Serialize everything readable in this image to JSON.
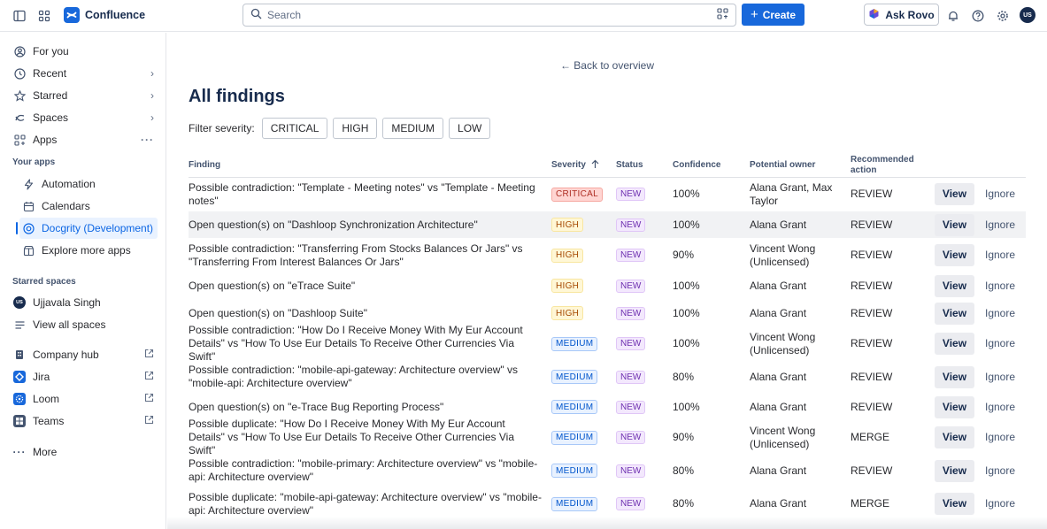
{
  "topbar": {
    "app_name": "Confluence",
    "search_placeholder": "Search",
    "create_label": "Create",
    "rovo_label": "Ask Rovo",
    "avatar_initials": "US"
  },
  "sidebar": {
    "main_items": [
      {
        "label": "For you",
        "icon": "user-circle-icon"
      },
      {
        "label": "Recent",
        "icon": "clock-icon"
      },
      {
        "label": "Starred",
        "icon": "star-icon"
      },
      {
        "label": "Spaces",
        "icon": "spaces-icon"
      },
      {
        "label": "Apps",
        "icon": "apps-grid-icon"
      }
    ],
    "your_apps_heading": "Your apps",
    "apps": [
      {
        "label": "Automation",
        "icon": "bolt-icon"
      },
      {
        "label": "Calendars",
        "icon": "calendar-icon"
      },
      {
        "label": "Docgrity (Development)",
        "icon": "docgrity-icon"
      },
      {
        "label": "Explore more apps",
        "icon": "marketplace-icon"
      }
    ],
    "starred_spaces_heading": "Starred spaces",
    "starred_space": {
      "label": "Ujjavala Singh",
      "initials": "US"
    },
    "view_all_spaces": "View all spaces",
    "external": [
      {
        "label": "Company hub",
        "icon": "company-hub-icon",
        "color": "#44546f"
      },
      {
        "label": "Jira",
        "icon": "jira-icon",
        "color": "#1868db"
      },
      {
        "label": "Loom",
        "icon": "loom-icon",
        "color": "#1868db"
      },
      {
        "label": "Teams",
        "icon": "teams-icon",
        "color": "#44546f"
      }
    ],
    "more_label": "More"
  },
  "main": {
    "back_link": "← Back to overview",
    "title": "All findings",
    "filter_label": "Filter severity:",
    "filters": [
      "CRITICAL",
      "HIGH",
      "MEDIUM",
      "LOW"
    ],
    "columns": {
      "finding": "Finding",
      "severity": "Severity",
      "status": "Status",
      "confidence": "Confidence",
      "owner": "Potential owner",
      "action": "Recommended action"
    },
    "view_label": "View",
    "ignore_label": "Ignore",
    "rows": [
      {
        "finding": "Possible contradiction: \"Template - Meeting notes\" vs \"Template - Meeting notes\"",
        "severity": "CRITICAL",
        "status": "NEW",
        "confidence": "100%",
        "owner": "Alana Grant, Max Taylor",
        "action": "REVIEW"
      },
      {
        "finding": "Open question(s) on \"Dashloop Synchronization Architecture\"",
        "severity": "HIGH",
        "status": "NEW",
        "confidence": "100%",
        "owner": "Alana Grant",
        "action": "REVIEW"
      },
      {
        "finding": "Possible contradiction: \"Transferring From Stocks Balances Or Jars\" vs \"Transferring From Interest Balances Or Jars\"",
        "severity": "HIGH",
        "status": "NEW",
        "confidence": "90%",
        "owner": "Vincent Wong (Unlicensed)",
        "action": "REVIEW"
      },
      {
        "finding": "Open question(s) on \"eTrace Suite\"",
        "severity": "HIGH",
        "status": "NEW",
        "confidence": "100%",
        "owner": "Alana Grant",
        "action": "REVIEW"
      },
      {
        "finding": "Open question(s) on \"Dashloop Suite\"",
        "severity": "HIGH",
        "status": "NEW",
        "confidence": "100%",
        "owner": "Alana Grant",
        "action": "REVIEW"
      },
      {
        "finding": "Possible contradiction: \"How Do I Receive Money With My Eur Account Details\" vs \"How To Use Eur Details To Receive Other Currencies Via Swift\"",
        "severity": "MEDIUM",
        "status": "NEW",
        "confidence": "100%",
        "owner": "Vincent Wong (Unlicensed)",
        "action": "REVIEW"
      },
      {
        "finding": "Possible contradiction: \"mobile-api-gateway: Architecture overview\" vs \"mobile-api: Architecture overview\"",
        "severity": "MEDIUM",
        "status": "NEW",
        "confidence": "80%",
        "owner": "Alana Grant",
        "action": "REVIEW"
      },
      {
        "finding": "Open question(s) on \"e-Trace Bug Reporting Process\"",
        "severity": "MEDIUM",
        "status": "NEW",
        "confidence": "100%",
        "owner": "Alana Grant",
        "action": "REVIEW"
      },
      {
        "finding": "Possible duplicate: \"How Do I Receive Money With My Eur Account Details\" vs \"How To Use Eur Details To Receive Other Currencies Via Swift\"",
        "severity": "MEDIUM",
        "status": "NEW",
        "confidence": "90%",
        "owner": "Vincent Wong (Unlicensed)",
        "action": "MERGE"
      },
      {
        "finding": "Possible contradiction: \"mobile-primary: Architecture overview\" vs \"mobile-api: Architecture overview\"",
        "severity": "MEDIUM",
        "status": "NEW",
        "confidence": "80%",
        "owner": "Alana Grant",
        "action": "REVIEW"
      },
      {
        "finding": "Possible duplicate: \"mobile-api-gateway: Architecture overview\" vs \"mobile-api: Architecture overview\"",
        "severity": "MEDIUM",
        "status": "NEW",
        "confidence": "80%",
        "owner": "Alana Grant",
        "action": "MERGE"
      }
    ]
  }
}
